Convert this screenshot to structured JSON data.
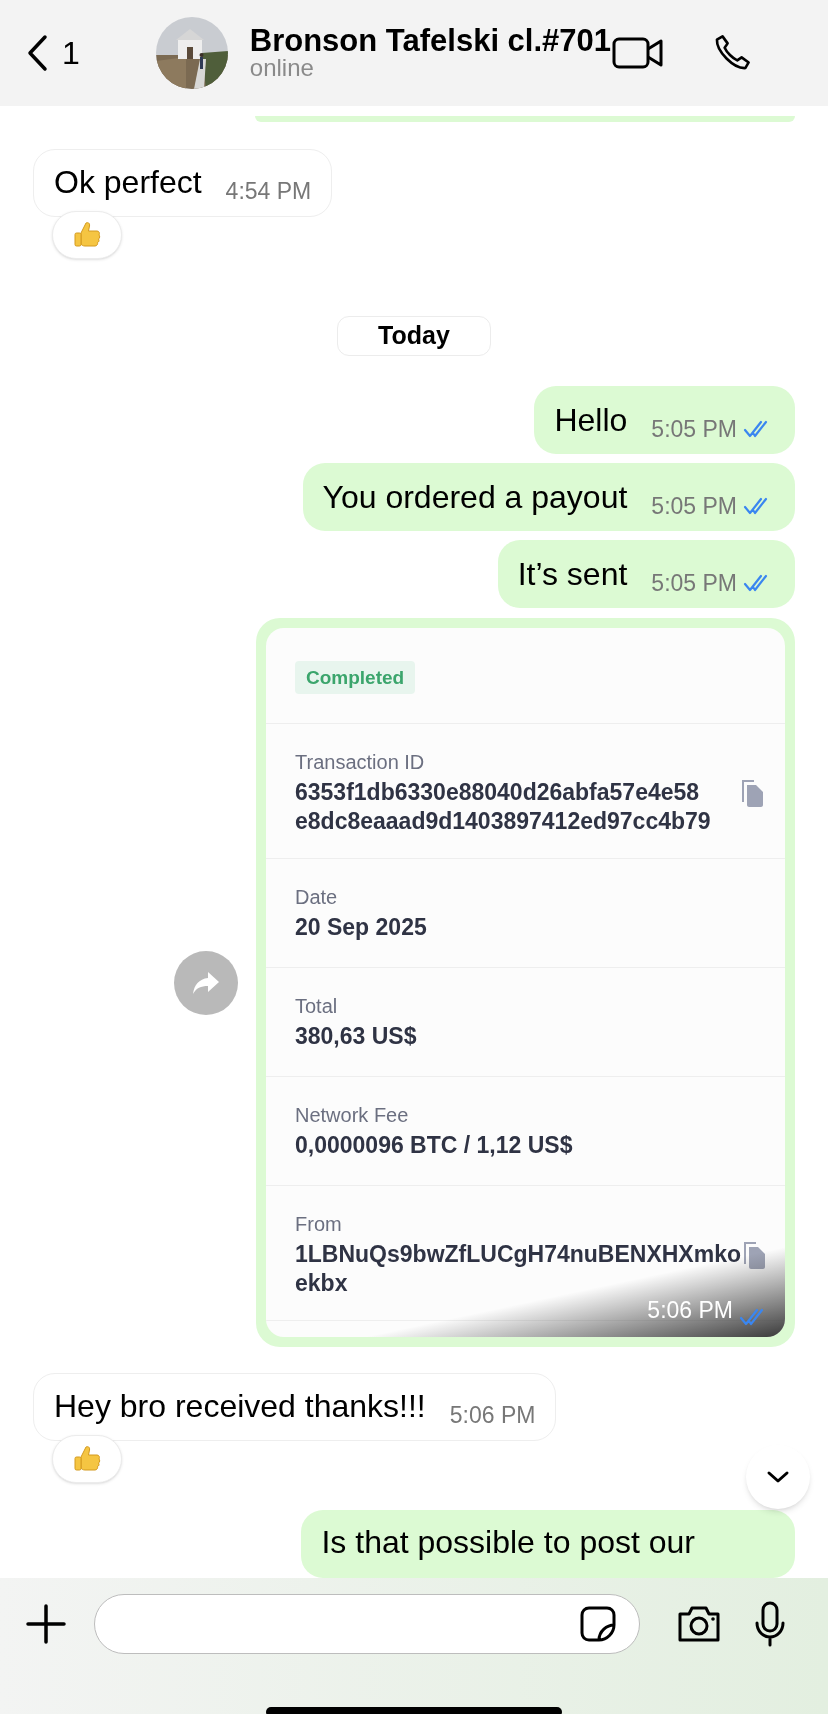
{
  "header": {
    "back_count": "1",
    "name": "Bronson Tafelski cl.#701",
    "status": "online"
  },
  "messages": [
    {
      "kind": "outgoing_edge"
    },
    {
      "kind": "incoming",
      "text": "Ok perfect",
      "time": "4:54 PM",
      "reacted": true
    },
    {
      "kind": "date",
      "text": "Today"
    },
    {
      "kind": "outgoing",
      "text": "Hello",
      "time": "5:05 PM",
      "read": true
    },
    {
      "kind": "outgoing",
      "text": "You ordered a payout",
      "time": "5:05 PM",
      "read": true
    },
    {
      "kind": "outgoing",
      "text": "It’s sent",
      "time": "5:05 PM",
      "read": true
    },
    {
      "kind": "receipt",
      "time": "5:06 PM",
      "read": true,
      "forward": true,
      "status": "Completed",
      "fields": [
        {
          "label": "Transaction ID",
          "lines": [
            "6353f1db6330e88040d26abfa57e4e58",
            "e8dc8eaaad9d1403897412ed97cc4b79"
          ],
          "copyable": true
        },
        {
          "label": "Date",
          "lines": [
            "20 Sep 2025"
          ],
          "copyable": false
        },
        {
          "label": "Total",
          "lines": [
            "380,63 US$"
          ],
          "copyable": false
        },
        {
          "label": "Network Fee",
          "lines": [
            "0,0000096 BTC / 1,12 US$"
          ],
          "copyable": false
        },
        {
          "label": "From",
          "lines": [
            "1LBNuQs9bwZfLUCgH74nuBENXHXmko",
            "ekbx"
          ],
          "copyable": true
        }
      ]
    },
    {
      "kind": "incoming",
      "text": "Hey bro received thanks!!!",
      "time": "5:06 PM",
      "reacted": true
    },
    {
      "kind": "outgoing_cut",
      "text": "Is that possible to post our"
    }
  ]
}
